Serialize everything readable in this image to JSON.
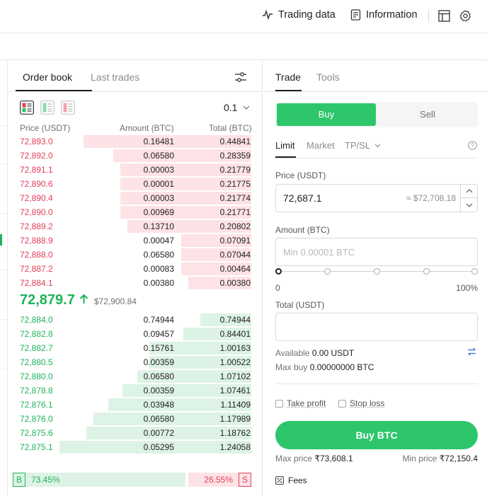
{
  "topbar": {
    "trading_data": "Trading data",
    "information": "Information",
    "layout_icon": "layout-icon",
    "settings_icon": "gear-icon"
  },
  "orderbook": {
    "tabs": [
      "Order book",
      "Last trades"
    ],
    "precision": "0.1",
    "headers": {
      "price": "Price (USDT)",
      "amount": "Amount (BTC)",
      "total": "Total (BTC)"
    },
    "asks": [
      {
        "price": "72,893.0",
        "amount": "0.16481",
        "total": "0.44841",
        "depth": 0.69
      },
      {
        "price": "72,892.0",
        "amount": "0.06580",
        "total": "0.28359",
        "depth": 0.57
      },
      {
        "price": "72,891.1",
        "amount": "0.00003",
        "total": "0.21779",
        "depth": 0.54
      },
      {
        "price": "72,890.6",
        "amount": "0.00001",
        "total": "0.21775",
        "depth": 0.54
      },
      {
        "price": "72,890.4",
        "amount": "0.00003",
        "total": "0.21774",
        "depth": 0.54
      },
      {
        "price": "72,890.0",
        "amount": "0.00969",
        "total": "0.21771",
        "depth": 0.54
      },
      {
        "price": "72,889.2",
        "amount": "0.13710",
        "total": "0.20802",
        "depth": 0.51
      },
      {
        "price": "72,888.9",
        "amount": "0.00047",
        "total": "0.07091",
        "depth": 0.29
      },
      {
        "price": "72,888.0",
        "amount": "0.06580",
        "total": "0.07044",
        "depth": 0.29
      },
      {
        "price": "72,887.2",
        "amount": "0.00083",
        "total": "0.00464",
        "depth": 0.29
      },
      {
        "price": "72,884.1",
        "amount": "0.00380",
        "total": "0.00380",
        "depth": 0.26
      }
    ],
    "last_price": "72,879.7",
    "index_price": "$72,900.84",
    "bids": [
      {
        "price": "72,884.0",
        "amount": "0.74944",
        "total": "0.74944",
        "depth": 0.21
      },
      {
        "price": "72,882.8",
        "amount": "0.09457",
        "total": "0.84401",
        "depth": 0.28
      },
      {
        "price": "72,882.7",
        "amount": "0.15761",
        "total": "1.00163",
        "depth": 0.42
      },
      {
        "price": "72,880.5",
        "amount": "0.00359",
        "total": "1.00522",
        "depth": 0.42
      },
      {
        "price": "72,880.0",
        "amount": "0.06580",
        "total": "1.07102",
        "depth": 0.47
      },
      {
        "price": "72,878.8",
        "amount": "0.00359",
        "total": "1.07461",
        "depth": 0.53
      },
      {
        "price": "72,876.1",
        "amount": "0.03948",
        "total": "1.11409",
        "depth": 0.59
      },
      {
        "price": "72,876.0",
        "amount": "0.06580",
        "total": "1.17989",
        "depth": 0.65
      },
      {
        "price": "72,875.6",
        "amount": "0.00772",
        "total": "1.18762",
        "depth": 0.68
      },
      {
        "price": "72,875.1",
        "amount": "0.05295",
        "total": "1.24058",
        "depth": 0.79
      }
    ],
    "ratio": {
      "buy_label": "B",
      "buy_pct": "73.45%",
      "sell_label": "S",
      "sell_pct": "26.55%",
      "buy_fraction": 0.7345
    }
  },
  "trade": {
    "tabs": [
      "Trade",
      "Tools"
    ],
    "buy": "Buy",
    "sell": "Sell",
    "order_types": [
      "Limit",
      "Market",
      "TP/SL"
    ],
    "price_label": "Price (USDT)",
    "price_value": "72,687.1",
    "price_approx": "≈ $72,708.18",
    "amount_label": "Amount (BTC)",
    "amount_placeholder": "Min 0.00001 BTC",
    "slider_min": "0",
    "slider_max": "100%",
    "total_label": "Total (USDT)",
    "available_label": "Available",
    "available_value": "0.00 USDT",
    "maxbuy_label": "Max buy",
    "maxbuy_value": "0.00000000 BTC",
    "take_profit": "Take profit",
    "stop_loss": "Stop loss",
    "buy_button": "Buy BTC",
    "max_price_label": "Max price",
    "max_price_value": "₹73,608.1",
    "min_price_label": "Min price",
    "min_price_value": "₹72,150.4",
    "fees": "Fees"
  },
  "colors": {
    "buy": "#2ec66a",
    "sell": "#e0405a",
    "ask_depth": "#fde2e6",
    "bid_depth": "#ddf3e5"
  }
}
